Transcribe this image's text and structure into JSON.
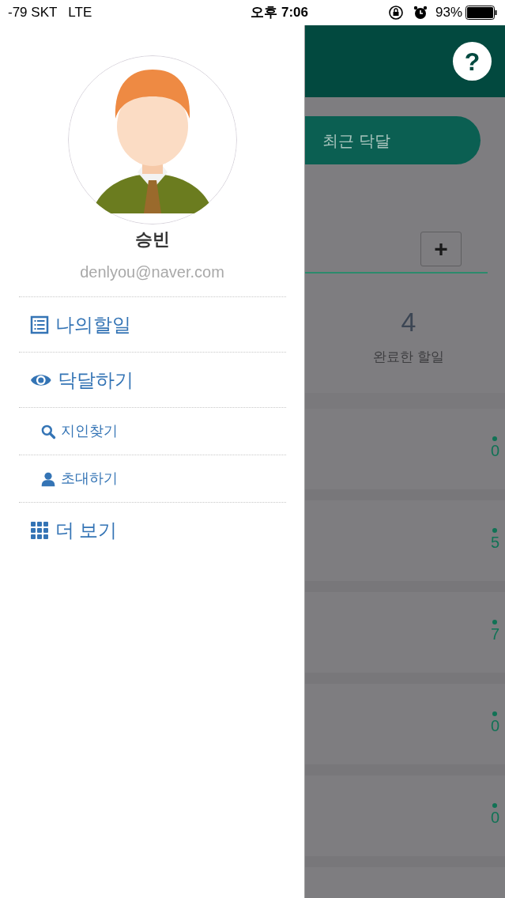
{
  "status_bar": {
    "carrier": "-79 SKT",
    "network": "LTE",
    "time": "오후 7:06",
    "battery": "93%"
  },
  "drawer": {
    "profile": {
      "name": "승빈",
      "email": "denlyou@naver.com"
    },
    "menu": [
      {
        "label": "나의할일",
        "kind": "large"
      },
      {
        "label": "닥달하기",
        "kind": "large"
      },
      {
        "label": "지인찾기",
        "kind": "small"
      },
      {
        "label": "초대하기",
        "kind": "small"
      },
      {
        "label": "더 보기",
        "kind": "large"
      }
    ]
  },
  "background": {
    "help_button": "?",
    "recent_tab": "최근 닥달",
    "add_button": "+",
    "completed": {
      "count": "4",
      "label": "완료한 할일"
    },
    "rows": [
      {
        "count": "0"
      },
      {
        "count": "5"
      },
      {
        "count": "7"
      },
      {
        "count": "0"
      },
      {
        "count": "0"
      }
    ]
  }
}
